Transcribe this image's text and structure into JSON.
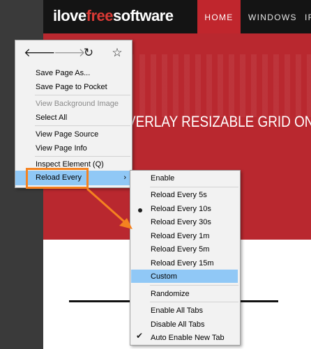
{
  "site": {
    "logo_prefix": "ilove",
    "logo_accent": "free",
    "logo_suffix": "software",
    "nav": {
      "home": "HOME",
      "windows": "WINDOWS",
      "next": "IF"
    },
    "hero_title": "VERLAY RESIZABLE GRID ON D"
  },
  "context_menu": {
    "nav_icons": [
      "back-arrow-icon",
      "forward-arrow-icon",
      "reload-icon",
      "bookmark-star-icon"
    ],
    "items": {
      "save_page_as": "Save Page As...",
      "save_to_pocket": "Save Page to Pocket",
      "view_background_image": "View Background Image",
      "select_all": "Select All",
      "view_page_source": "View Page Source",
      "view_page_info": "View Page Info",
      "inspect_element": "Inspect Element (Q)",
      "reload_every": "Reload Every"
    },
    "submenu_arrow": "›"
  },
  "reload_every_submenu": {
    "enable": "Enable",
    "intervals": [
      "Reload Every 5s",
      "Reload Every 10s",
      "Reload Every 30s",
      "Reload Every 1m",
      "Reload Every 5m",
      "Reload Every 15m"
    ],
    "custom": "Custom",
    "randomize": "Randomize",
    "enable_all_tabs": "Enable All Tabs",
    "disable_all_tabs": "Disable All Tabs",
    "auto_enable_new_tab": "Auto Enable New Tab",
    "selected_interval": "Reload Every 10s",
    "auto_enable_checked": true,
    "check_glyph": "✔"
  },
  "colors": {
    "hover_highlight": "#90c8f6",
    "annotation_orange": "#f58220",
    "brand_red": "#c0262d"
  }
}
